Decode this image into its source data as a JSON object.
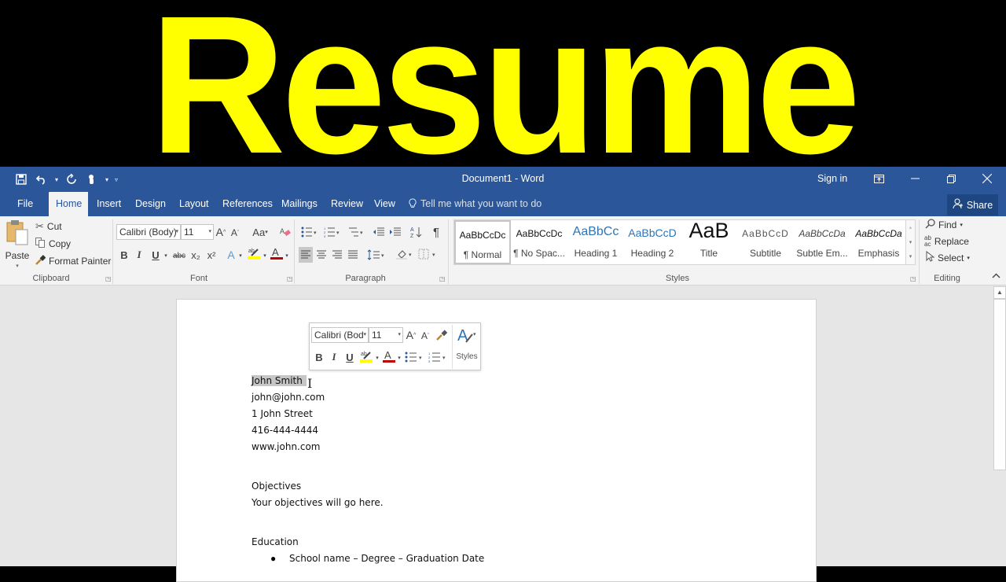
{
  "banner": {
    "text": "Resume",
    "color": "#ffff00"
  },
  "titlebar": {
    "document_title": "Document1  -  Word",
    "sign_in": "Sign in",
    "qat": {
      "save": "save-icon",
      "undo": "undo-icon",
      "redo": "redo-icon",
      "touch": "touch-mode-icon",
      "customize": "customize-qat-icon"
    },
    "window_controls": [
      "ribbon-display-options",
      "minimize",
      "restore",
      "close"
    ]
  },
  "tabs": {
    "items": [
      "File",
      "Home",
      "Insert",
      "Design",
      "Layout",
      "References",
      "Mailings",
      "Review",
      "View"
    ],
    "active": "Home",
    "tell_me": "Tell me what you want to do",
    "share": "Share"
  },
  "ribbon": {
    "clipboard": {
      "paste": "Paste",
      "cut": "Cut",
      "copy": "Copy",
      "format_painter": "Format Painter",
      "label": "Clipboard"
    },
    "font": {
      "font_name": "Calibri (Body)",
      "font_size": "11",
      "change_case": "Aa",
      "label": "Font",
      "bold": "B",
      "italic": "I",
      "underline": "U",
      "strikethrough": "abc",
      "subscript": "x₂",
      "superscript": "x²"
    },
    "paragraph": {
      "label": "Paragraph"
    },
    "styles": {
      "label": "Styles",
      "items": [
        {
          "preview": "AaBbCcDc",
          "name": "¶ Normal"
        },
        {
          "preview": "AaBbCcDc",
          "name": "¶ No Spac..."
        },
        {
          "preview": "AaBbCc",
          "name": "Heading 1"
        },
        {
          "preview": "AaBbCcD",
          "name": "Heading 2"
        },
        {
          "preview": "AaB",
          "name": "Title"
        },
        {
          "preview": "AaBbCcD",
          "name": "Subtitle"
        },
        {
          "preview": "AaBbCcDa",
          "name": "Subtle Em..."
        },
        {
          "preview": "AaBbCcDa",
          "name": "Emphasis"
        }
      ],
      "selected": "¶ Normal"
    },
    "editing": {
      "find": "Find",
      "replace": "Replace",
      "select": "Select",
      "label": "Editing"
    }
  },
  "mini_toolbar": {
    "font_name": "Calibri (Bod",
    "font_size": "11",
    "bold": "B",
    "italic": "I",
    "underline": "U",
    "styles": "Styles"
  },
  "document": {
    "lines": [
      "John Smith",
      "john@john.com",
      "1 John Street",
      "416-444-4444",
      "www.john.com",
      "Objectives",
      "Your objectives will go here.",
      "Education"
    ],
    "bullets": [
      "School name – Degree – Graduation Date"
    ],
    "selected_text": "John Smith"
  },
  "colors": {
    "accent": "#2b579a",
    "highlight": "#ffff00",
    "font_color": "#c00000"
  }
}
